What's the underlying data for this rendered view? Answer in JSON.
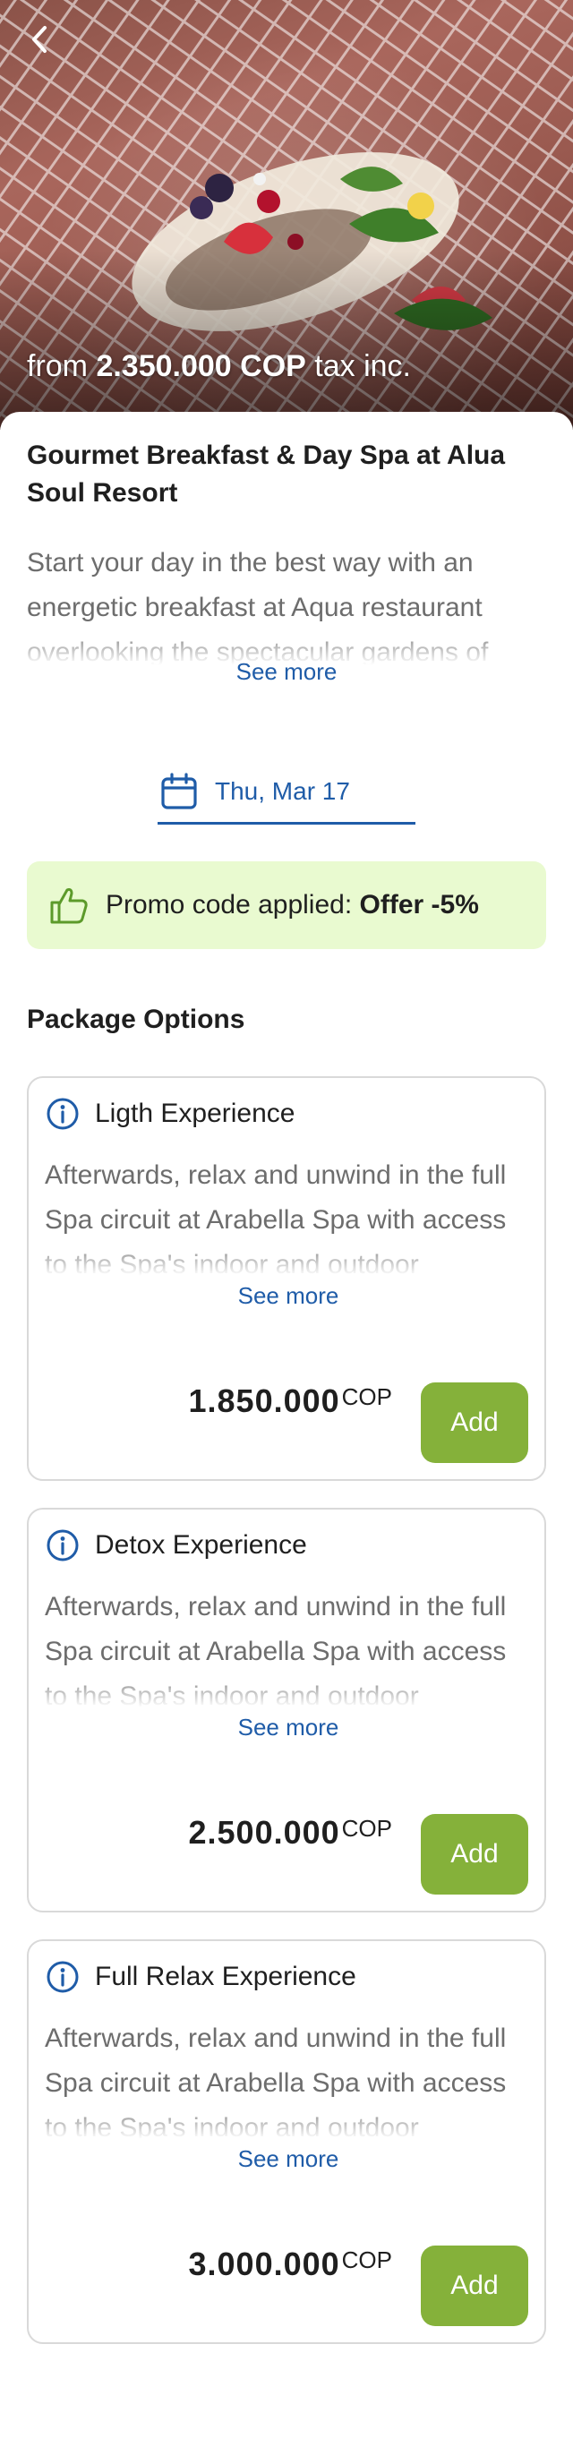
{
  "hero": {
    "price_prefix": "from",
    "price_value": "2.350.000 COP",
    "price_suffix": "tax inc.",
    "back_icon": "chevron-left-icon"
  },
  "package": {
    "title": "Gourmet Breakfast & Day Spa at Alua Soul Resort",
    "description": "Start your day in the best way with an energetic breakfast at Aqua restaurant overlooking the spectacular gardens of",
    "see_more": "See more"
  },
  "date": {
    "label": "Thu, Mar 17",
    "icon": "calendar-icon"
  },
  "promo": {
    "text": "Promo code applied:",
    "code": "Offer -5%",
    "icon": "thumbs-up-icon",
    "background": "#e9fad0"
  },
  "options_title": "Package Options",
  "options": [
    {
      "name": "Ligth Experience",
      "description": "Afterwards, relax and unwind in the full Spa circuit at Arabella Spa with access to the Spa's indoor and outdoor",
      "see_more": "See more",
      "price": "1.850.000",
      "currency": "COP",
      "add_label": "Add"
    },
    {
      "name": "Detox Experience",
      "description": "Afterwards, relax and unwind in the full Spa circuit at Arabella Spa with access to the Spa's indoor and outdoor",
      "see_more": "See more",
      "price": "2.500.000",
      "currency": "COP",
      "add_label": "Add"
    },
    {
      "name": "Full Relax Experience",
      "description": "Afterwards, relax and unwind in the full Spa circuit at Arabella Spa with access to the Spa's indoor and outdoor",
      "see_more": "See more",
      "price": "3.000.000",
      "currency": "COP",
      "add_label": "Add"
    }
  ],
  "colors": {
    "accent": "#1f5ca8",
    "add_button": "#85b13a",
    "promo_bg": "#e9fad0"
  }
}
